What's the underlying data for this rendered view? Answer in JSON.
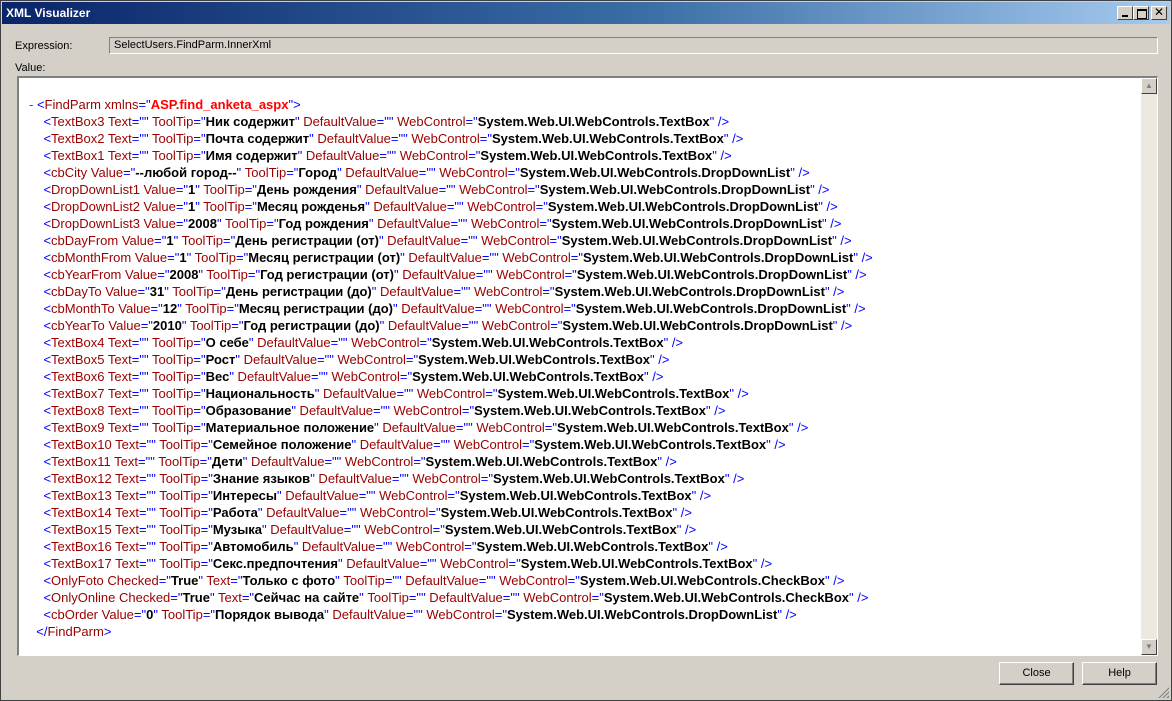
{
  "window": {
    "title": "XML Visualizer"
  },
  "expression": {
    "label": "Expression:",
    "value": "SelectUsers.FindParm.InnerXml"
  },
  "value_label": "Value:",
  "xml": {
    "root_open": {
      "minus": "-",
      "tag": "FindParm",
      "attr": "xmlns",
      "ns_value": "ASP.find_anketa_aspx"
    },
    "root_close": "FindParm",
    "elements": [
      {
        "tag": "TextBox3",
        "attrs": [
          [
            "Text",
            ""
          ],
          [
            "ToolTip",
            "Ник содержит"
          ],
          [
            "DefaultValue",
            ""
          ],
          [
            "WebControl",
            "System.Web.UI.WebControls.TextBox"
          ]
        ]
      },
      {
        "tag": "TextBox2",
        "attrs": [
          [
            "Text",
            ""
          ],
          [
            "ToolTip",
            "Почта содержит"
          ],
          [
            "DefaultValue",
            ""
          ],
          [
            "WebControl",
            "System.Web.UI.WebControls.TextBox"
          ]
        ]
      },
      {
        "tag": "TextBox1",
        "attrs": [
          [
            "Text",
            ""
          ],
          [
            "ToolTip",
            "Имя содержит"
          ],
          [
            "DefaultValue",
            ""
          ],
          [
            "WebControl",
            "System.Web.UI.WebControls.TextBox"
          ]
        ]
      },
      {
        "tag": "cbCity",
        "attrs": [
          [
            "Value",
            "--любой город--"
          ],
          [
            "ToolTip",
            "Город"
          ],
          [
            "DefaultValue",
            ""
          ],
          [
            "WebControl",
            "System.Web.UI.WebControls.DropDownList"
          ]
        ]
      },
      {
        "tag": "DropDownList1",
        "attrs": [
          [
            "Value",
            "1"
          ],
          [
            "ToolTip",
            "День рождения"
          ],
          [
            "DefaultValue",
            ""
          ],
          [
            "WebControl",
            "System.Web.UI.WebControls.DropDownList"
          ]
        ]
      },
      {
        "tag": "DropDownList2",
        "attrs": [
          [
            "Value",
            "1"
          ],
          [
            "ToolTip",
            "Месяц рожденья"
          ],
          [
            "DefaultValue",
            ""
          ],
          [
            "WebControl",
            "System.Web.UI.WebControls.DropDownList"
          ]
        ]
      },
      {
        "tag": "DropDownList3",
        "attrs": [
          [
            "Value",
            "2008"
          ],
          [
            "ToolTip",
            "Год рождения"
          ],
          [
            "DefaultValue",
            ""
          ],
          [
            "WebControl",
            "System.Web.UI.WebControls.DropDownList"
          ]
        ]
      },
      {
        "tag": "cbDayFrom",
        "attrs": [
          [
            "Value",
            "1"
          ],
          [
            "ToolTip",
            "День регистрации (от)"
          ],
          [
            "DefaultValue",
            ""
          ],
          [
            "WebControl",
            "System.Web.UI.WebControls.DropDownList"
          ]
        ]
      },
      {
        "tag": "cbMonthFrom",
        "attrs": [
          [
            "Value",
            "1"
          ],
          [
            "ToolTip",
            "Месяц регистрации (от)"
          ],
          [
            "DefaultValue",
            ""
          ],
          [
            "WebControl",
            "System.Web.UI.WebControls.DropDownList"
          ]
        ]
      },
      {
        "tag": "cbYearFrom",
        "attrs": [
          [
            "Value",
            "2008"
          ],
          [
            "ToolTip",
            "Год регистрации (от)"
          ],
          [
            "DefaultValue",
            ""
          ],
          [
            "WebControl",
            "System.Web.UI.WebControls.DropDownList"
          ]
        ]
      },
      {
        "tag": "cbDayTo",
        "attrs": [
          [
            "Value",
            "31"
          ],
          [
            "ToolTip",
            "День регистрации (до)"
          ],
          [
            "DefaultValue",
            ""
          ],
          [
            "WebControl",
            "System.Web.UI.WebControls.DropDownList"
          ]
        ]
      },
      {
        "tag": "cbMonthTo",
        "attrs": [
          [
            "Value",
            "12"
          ],
          [
            "ToolTip",
            "Месяц регистрации (до)"
          ],
          [
            "DefaultValue",
            ""
          ],
          [
            "WebControl",
            "System.Web.UI.WebControls.DropDownList"
          ]
        ]
      },
      {
        "tag": "cbYearTo",
        "attrs": [
          [
            "Value",
            "2010"
          ],
          [
            "ToolTip",
            "Год регистрации (до)"
          ],
          [
            "DefaultValue",
            ""
          ],
          [
            "WebControl",
            "System.Web.UI.WebControls.DropDownList"
          ]
        ]
      },
      {
        "tag": "TextBox4",
        "attrs": [
          [
            "Text",
            ""
          ],
          [
            "ToolTip",
            "О себе"
          ],
          [
            "DefaultValue",
            ""
          ],
          [
            "WebControl",
            "System.Web.UI.WebControls.TextBox"
          ]
        ]
      },
      {
        "tag": "TextBox5",
        "attrs": [
          [
            "Text",
            ""
          ],
          [
            "ToolTip",
            "Рост"
          ],
          [
            "DefaultValue",
            ""
          ],
          [
            "WebControl",
            "System.Web.UI.WebControls.TextBox"
          ]
        ]
      },
      {
        "tag": "TextBox6",
        "attrs": [
          [
            "Text",
            ""
          ],
          [
            "ToolTip",
            "Вес"
          ],
          [
            "DefaultValue",
            ""
          ],
          [
            "WebControl",
            "System.Web.UI.WebControls.TextBox"
          ]
        ]
      },
      {
        "tag": "TextBox7",
        "attrs": [
          [
            "Text",
            ""
          ],
          [
            "ToolTip",
            "Национальность"
          ],
          [
            "DefaultValue",
            ""
          ],
          [
            "WebControl",
            "System.Web.UI.WebControls.TextBox"
          ]
        ]
      },
      {
        "tag": "TextBox8",
        "attrs": [
          [
            "Text",
            ""
          ],
          [
            "ToolTip",
            "Образование"
          ],
          [
            "DefaultValue",
            ""
          ],
          [
            "WebControl",
            "System.Web.UI.WebControls.TextBox"
          ]
        ]
      },
      {
        "tag": "TextBox9",
        "attrs": [
          [
            "Text",
            ""
          ],
          [
            "ToolTip",
            "Материальное положение"
          ],
          [
            "DefaultValue",
            ""
          ],
          [
            "WebControl",
            "System.Web.UI.WebControls.TextBox"
          ]
        ]
      },
      {
        "tag": "TextBox10",
        "attrs": [
          [
            "Text",
            ""
          ],
          [
            "ToolTip",
            "Семейное положение"
          ],
          [
            "DefaultValue",
            ""
          ],
          [
            "WebControl",
            "System.Web.UI.WebControls.TextBox"
          ]
        ]
      },
      {
        "tag": "TextBox11",
        "attrs": [
          [
            "Text",
            ""
          ],
          [
            "ToolTip",
            "Дети"
          ],
          [
            "DefaultValue",
            ""
          ],
          [
            "WebControl",
            "System.Web.UI.WebControls.TextBox"
          ]
        ]
      },
      {
        "tag": "TextBox12",
        "attrs": [
          [
            "Text",
            ""
          ],
          [
            "ToolTip",
            "Знание языков"
          ],
          [
            "DefaultValue",
            ""
          ],
          [
            "WebControl",
            "System.Web.UI.WebControls.TextBox"
          ]
        ]
      },
      {
        "tag": "TextBox13",
        "attrs": [
          [
            "Text",
            ""
          ],
          [
            "ToolTip",
            "Интересы"
          ],
          [
            "DefaultValue",
            ""
          ],
          [
            "WebControl",
            "System.Web.UI.WebControls.TextBox"
          ]
        ]
      },
      {
        "tag": "TextBox14",
        "attrs": [
          [
            "Text",
            ""
          ],
          [
            "ToolTip",
            "Работа"
          ],
          [
            "DefaultValue",
            ""
          ],
          [
            "WebControl",
            "System.Web.UI.WebControls.TextBox"
          ]
        ]
      },
      {
        "tag": "TextBox15",
        "attrs": [
          [
            "Text",
            ""
          ],
          [
            "ToolTip",
            "Музыка"
          ],
          [
            "DefaultValue",
            ""
          ],
          [
            "WebControl",
            "System.Web.UI.WebControls.TextBox"
          ]
        ]
      },
      {
        "tag": "TextBox16",
        "attrs": [
          [
            "Text",
            ""
          ],
          [
            "ToolTip",
            "Автомобиль"
          ],
          [
            "DefaultValue",
            ""
          ],
          [
            "WebControl",
            "System.Web.UI.WebControls.TextBox"
          ]
        ]
      },
      {
        "tag": "TextBox17",
        "attrs": [
          [
            "Text",
            ""
          ],
          [
            "ToolTip",
            "Секс.предпочтения"
          ],
          [
            "DefaultValue",
            ""
          ],
          [
            "WebControl",
            "System.Web.UI.WebControls.TextBox"
          ]
        ]
      },
      {
        "tag": "OnlyFoto",
        "attrs": [
          [
            "Checked",
            "True"
          ],
          [
            "Text",
            "Только с фото"
          ],
          [
            "ToolTip",
            ""
          ],
          [
            "DefaultValue",
            ""
          ],
          [
            "WebControl",
            "System.Web.UI.WebControls.CheckBox"
          ]
        ]
      },
      {
        "tag": "OnlyOnline",
        "attrs": [
          [
            "Checked",
            "True"
          ],
          [
            "Text",
            "Сейчас на сайте"
          ],
          [
            "ToolTip",
            ""
          ],
          [
            "DefaultValue",
            ""
          ],
          [
            "WebControl",
            "System.Web.UI.WebControls.CheckBox"
          ]
        ]
      },
      {
        "tag": "cbOrder",
        "attrs": [
          [
            "Value",
            "0"
          ],
          [
            "ToolTip",
            "Порядок вывода"
          ],
          [
            "DefaultValue",
            ""
          ],
          [
            "WebControl",
            "System.Web.UI.WebControls.DropDownList"
          ]
        ]
      }
    ]
  },
  "buttons": {
    "close": "Close",
    "help": "Help"
  },
  "scrollbar": {
    "up_glyph": "▲",
    "down_glyph": "▼"
  },
  "colors": {
    "title_bar": "#0a246a",
    "tag": "#990000",
    "bracket": "#0000ff",
    "value": "#000000",
    "namespace": "#ff0000"
  }
}
